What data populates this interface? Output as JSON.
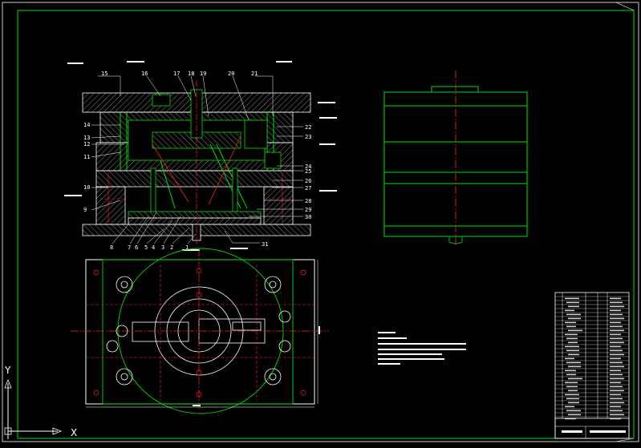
{
  "drawing": {
    "type": "injection mould assembly drawing",
    "colors": {
      "background": "#000000",
      "outline": "#00e000",
      "part_edge": "#ffffff",
      "hatch": "#c8c8c8",
      "centerline": "#ff2020",
      "hidden_line": "#ff2020",
      "dimension": "#ffffff",
      "leader": "#ffffff"
    },
    "section_view": {
      "callouts_top": [
        "15",
        "16",
        "17",
        "18",
        "19",
        "20",
        "21"
      ],
      "callouts_left": [
        "14",
        "13",
        "12",
        "11",
        "10",
        "9"
      ],
      "callouts_right": [
        "22",
        "23",
        "24",
        "25",
        "26",
        "27",
        "28",
        "29",
        "30"
      ],
      "callouts_bottom": [
        "8",
        "7",
        "6",
        "5",
        "4",
        "3",
        "2",
        "1",
        "31"
      ]
    },
    "ucs": {
      "x_label": "X",
      "y_label": "Y"
    }
  }
}
